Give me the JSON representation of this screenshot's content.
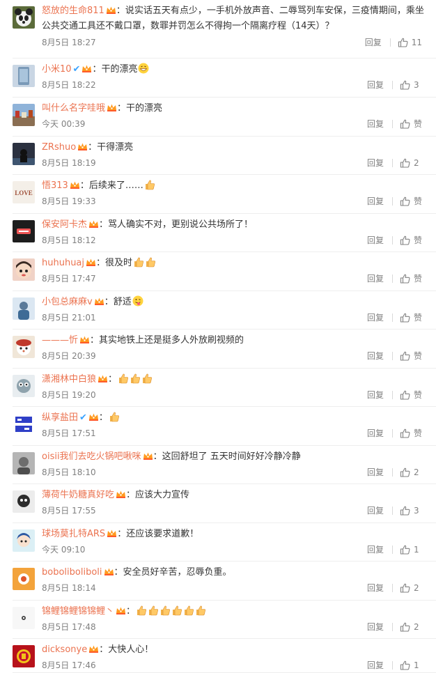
{
  "ui": {
    "reply_label": "回复",
    "like_label": "赞"
  },
  "comments": [
    {
      "name": "怒放的生命811",
      "text": "：说实话五天有点少，一手机外放声音、二辱骂列车安保，三疫情期间，乘坐公共交通工具还不戴口罩，数罪并罚怎么不得拘一个隔离疗程（14天）？",
      "time": "8月5日 18:27",
      "likes": "11",
      "avatar": "panda-avatar",
      "verified": false,
      "emojis": []
    },
    {
      "name": "小米10",
      "text": "：干的漂亮",
      "time": "8月5日 18:22",
      "likes": "3",
      "avatar": "phone-avatar",
      "verified": true,
      "emojis": [
        "grin"
      ]
    },
    {
      "name": "叫什么名字哇哦",
      "text": "：干的漂亮",
      "time": "今天 00:39",
      "likes": "赞",
      "avatar": "city-avatar",
      "verified": false,
      "emojis": []
    },
    {
      "name": "ZRshuo",
      "text": "：干得漂亮",
      "time": "8月5日 18:19",
      "likes": "2",
      "avatar": "dark-avatar",
      "verified": false,
      "emojis": []
    },
    {
      "name": "悟313",
      "text": "：后续来了……",
      "time": "8月5日 19:33",
      "likes": "赞",
      "avatar": "love-avatar",
      "verified": false,
      "emojis": [
        "thumb"
      ]
    },
    {
      "name": "保安阿卡杰",
      "text": "：骂人确实不对，更别说公共场所了！",
      "time": "8月5日 18:12",
      "likes": "赞",
      "avatar": "black-avatar",
      "verified": false,
      "emojis": []
    },
    {
      "name": "huhuhuaj",
      "text": "：很及时",
      "time": "8月5日 17:47",
      "likes": "赞",
      "avatar": "kid-avatar",
      "verified": false,
      "emojis": [
        "thumb",
        "thumb"
      ]
    },
    {
      "name": "小包总麻麻v",
      "text": "：舒适",
      "time": "8月5日 21:01",
      "likes": "赞",
      "avatar": "blue-avatar",
      "verified": false,
      "emojis": [
        "tongue"
      ]
    },
    {
      "name": "———忻",
      "text": "：其实地铁上还是挺多人外放刷视频的",
      "time": "8月5日 20:39",
      "likes": "赞",
      "avatar": "cat-avatar",
      "verified": false,
      "emojis": []
    },
    {
      "name": "潇湘林中白狼",
      "text": "：",
      "time": "8月5日 19:20",
      "likes": "赞",
      "avatar": "wolf-avatar",
      "verified": false,
      "emojis": [
        "thumb",
        "thumb",
        "thumb"
      ]
    },
    {
      "name": "纵享盐田",
      "text": "：",
      "time": "8月5日 17:51",
      "likes": "赞",
      "avatar": "text-avatar",
      "verified": true,
      "emojis": [
        "thumb"
      ]
    },
    {
      "name": "oisii我们去吃火锅吧啾咪",
      "text": "：这回舒坦了 五天时间好好冷静冷静",
      "time": "8月5日 18:10",
      "likes": "2",
      "avatar": "gray-avatar",
      "verified": false,
      "emojis": []
    },
    {
      "name": "薄荷牛奶糖真好吃",
      "text": "：应该大力宣传",
      "time": "8月5日 17:55",
      "likes": "3",
      "avatar": "bw-avatar",
      "verified": false,
      "emojis": []
    },
    {
      "name": "球场莫扎特ARS",
      "text": "：还应该要求道歉！",
      "time": "今天 09:10",
      "likes": "1",
      "avatar": "anime-avatar",
      "verified": false,
      "emojis": []
    },
    {
      "name": "boboliboliboli",
      "text": "：安全员好辛苦，忍辱负重。",
      "time": "8月5日 18:14",
      "likes": "2",
      "avatar": "orange-avatar",
      "verified": false,
      "emojis": []
    },
    {
      "name": "锦鲤锦鲤锦锦鲤丶",
      "text": "：",
      "time": "8月5日 17:48",
      "likes": "2",
      "avatar": "white-avatar",
      "verified": false,
      "emojis": [
        "thumb",
        "thumb",
        "thumb",
        "thumb",
        "thumb",
        "thumb"
      ]
    },
    {
      "name": "dicksonye",
      "text": "：大快人心！",
      "time": "8月5日 17:46",
      "likes": "1",
      "avatar": "club-avatar",
      "verified": false,
      "emojis": []
    }
  ]
}
